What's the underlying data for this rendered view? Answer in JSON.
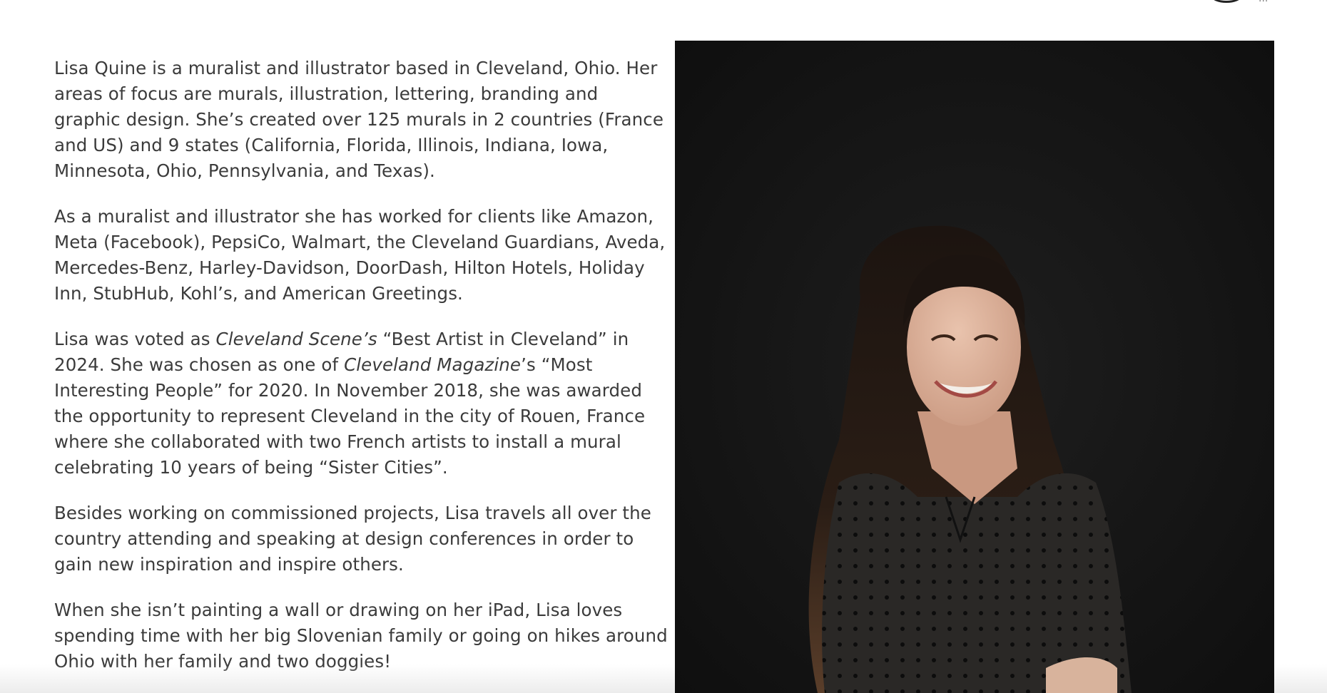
{
  "header": {
    "partial_label": "..."
  },
  "bio": {
    "p1": "Lisa Quine is a muralist and illustrator based in Cleveland, Ohio. Her areas of focus are murals, illustration, lettering, branding and graphic design. She’s created over 125 murals in 2 countries (France and US) and 9 states (California, Florida, Illinois, Indiana, Iowa, Minnesota, Ohio, Pennsylvania, and Texas).",
    "p2": "As a muralist and illustrator she has worked for clients like Amazon, Meta (Facebook), PepsiCo, Walmart, the Cleveland Guardians, Aveda, Mercedes-Benz, Harley-Davidson, DoorDash, Hilton Hotels, Holiday Inn, StubHub, Kohl’s, and American Greetings.",
    "p3": {
      "part1": "Lisa was voted as ",
      "scene": "Cleveland Scene’s",
      "part2": " “Best Artist in Cleveland” in 2024. She was chosen as one of ",
      "magazine": "Cleveland Magazine",
      "part3": "’s “Most Interesting People” for 2020. In November 2018, she was awarded the opportunity to represent Cleveland in the city of Rouen, France where she collaborated with two French artists to install a mural celebrating 10 years of being “Sister Cities”."
    },
    "p4": "Besides working on commissioned projects, Lisa travels all over the country attending and speaking at design conferences in order to gain new inspiration and inspire others.",
    "p5": "When she isn’t painting a wall or drawing on her iPad, Lisa loves spending time with her big Slovenian family or going on hikes around Ohio with her family and two doggies!"
  },
  "photo": {
    "background_color": "#141414"
  }
}
